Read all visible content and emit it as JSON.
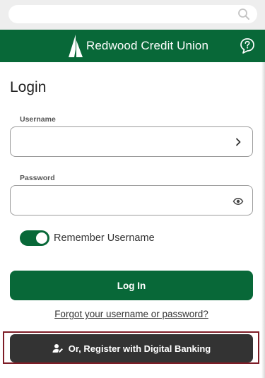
{
  "search": {
    "placeholder": "",
    "icon": "search-icon"
  },
  "header": {
    "brand_name": "Redwood Credit Union",
    "logo": "redwood-tree-logo",
    "help_icon": "help-chat-icon",
    "background_color": "#086838"
  },
  "login": {
    "title": "Login",
    "username_label": "Username",
    "username_value": "",
    "username_icon": "chevron-right-icon",
    "password_label": "Password",
    "password_value": "",
    "password_icon": "eye-icon",
    "remember_label": "Remember Username",
    "remember_enabled": true,
    "login_button": "Log In",
    "forgot_link": "Forgot your username or password?",
    "register_button": "Or, Register with Digital Banking",
    "register_icon": "user-edit-icon"
  },
  "colors": {
    "primary": "#086838",
    "register_button": "#333333",
    "highlight_border": "#7d1c26"
  }
}
